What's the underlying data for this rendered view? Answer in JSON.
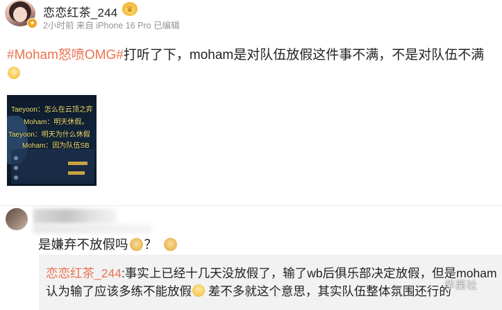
{
  "post": {
    "username": "恋恋红茶_244",
    "meta": "2小时前 来自 iPhone 16 Pro 已编辑",
    "hashtag": "#Moham怒喷OMG#",
    "body": "打听了下，moham是对队伍放假这件事不满，不是对队伍不满",
    "image": {
      "lines": [
        "Taeyoon：怎么在云顶之弈",
        "Moham：明天休假。",
        "Taeyoon：明天为什么休假",
        "Moham：因为队伍SB"
      ]
    }
  },
  "comment": {
    "text": "是嫌弃不放假吗",
    "question": "？",
    "reply": {
      "user": "恋恋红茶_244",
      "text_part1": ":事实上已经十几天没放假了，输了wb后俱乐部决定放假，但是moham认为输了应该多练不能放假",
      "text_part2": " 差不多就这个意思，其实队伍整体氛围还行的"
    }
  },
  "watermark": "华西社",
  "colors": {
    "accent": "#eb7350",
    "meta_gray": "#939393",
    "reply_bg": "#f2f2f2"
  },
  "icons": {
    "crown": "crown-badge-icon",
    "vip": "vip-badge-icon",
    "emoji": "smile-emoji-icon",
    "dog": "doge-emoji-icon"
  }
}
